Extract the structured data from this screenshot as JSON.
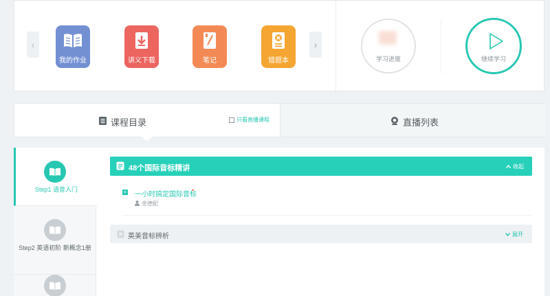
{
  "toolbar": {
    "prev_arrow": "‹",
    "next_arrow": "›",
    "tools": [
      {
        "label": "我的作业",
        "icon": "book-icon",
        "color": "#7390d3"
      },
      {
        "label": "讲义下载",
        "icon": "download-icon",
        "color": "#ec655f"
      },
      {
        "label": "笔记",
        "icon": "note-icon",
        "color": "#f38a55"
      },
      {
        "label": "错题本",
        "icon": "error-book-icon",
        "color": "#f5a531"
      }
    ]
  },
  "progress": {
    "label": "学习进度"
  },
  "continue": {
    "label": "继续学习",
    "color": "#27c7b2"
  },
  "tabs": {
    "catalog": "课程目录",
    "only_live": "只看直播课程",
    "live_list": "直播列表"
  },
  "steps": [
    {
      "label": "Step1 语音入门",
      "active": true
    },
    {
      "label": "Step2 英语初阶 新概念1册",
      "active": false
    },
    {
      "label": "",
      "active": false
    }
  ],
  "sections": [
    {
      "title": "48个国际音标精讲",
      "toggle": "收起",
      "expanded": true,
      "lessons": [
        {
          "title": "一小时搞定国际音标",
          "marker": "•",
          "teacher": "金德配"
        }
      ]
    },
    {
      "title": "英美音标辨析",
      "toggle": "展开",
      "expanded": false
    }
  ]
}
